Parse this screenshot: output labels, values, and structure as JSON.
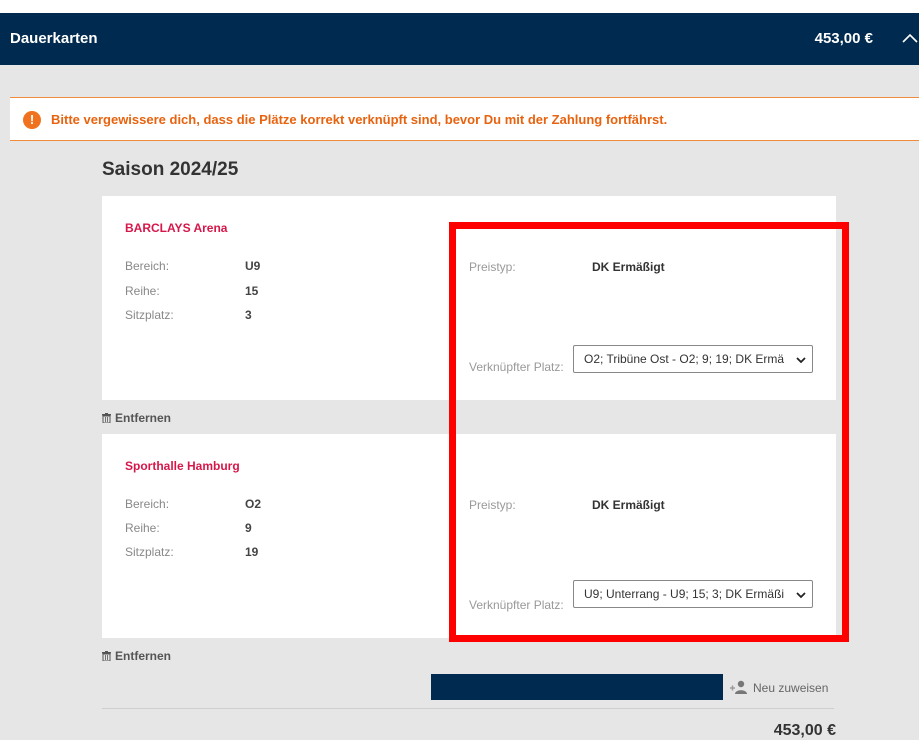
{
  "header": {
    "title": "Dauerkarten",
    "total": "453,00 €"
  },
  "alert": {
    "text": "Bitte vergewissere dich, dass die Plätze korrekt verknüpft sind, bevor Du mit der Zahlung fortfährst."
  },
  "season": "Saison 2024/25",
  "tickets": [
    {
      "venue": "BARCLAYS Arena",
      "bereich_label": "Bereich:",
      "bereich": "U9",
      "reihe_label": "Reihe:",
      "reihe": "15",
      "sitzplatz_label": "Sitzplatz:",
      "sitzplatz": "3",
      "preistyp_label": "Preistyp:",
      "preistyp": "DK Ermäßigt",
      "linked_label": "Verknüpfter Platz:",
      "linked": "O2; Tribüne Ost - O2; 9; 19; DK Ermä",
      "remove": "Entfernen"
    },
    {
      "venue": "Sporthalle Hamburg",
      "bereich_label": "Bereich:",
      "bereich": "O2",
      "reihe_label": "Reihe:",
      "reihe": "9",
      "sitzplatz_label": "Sitzplatz:",
      "sitzplatz": "19",
      "preistyp_label": "Preistyp:",
      "preistyp": "DK Ermäßigt",
      "linked_label": "Verknüpfter Platz:",
      "linked": "U9; Unterrang - U9; 15; 3; DK Ermäßi",
      "remove": "Entfernen"
    }
  ],
  "reassign": "Neu zuweisen",
  "bottom_total": "453,00 €",
  "colors": {
    "navy": "#002a4f",
    "accent": "#d6174a",
    "warning": "#f0721e",
    "highlight": "#ff0000"
  }
}
